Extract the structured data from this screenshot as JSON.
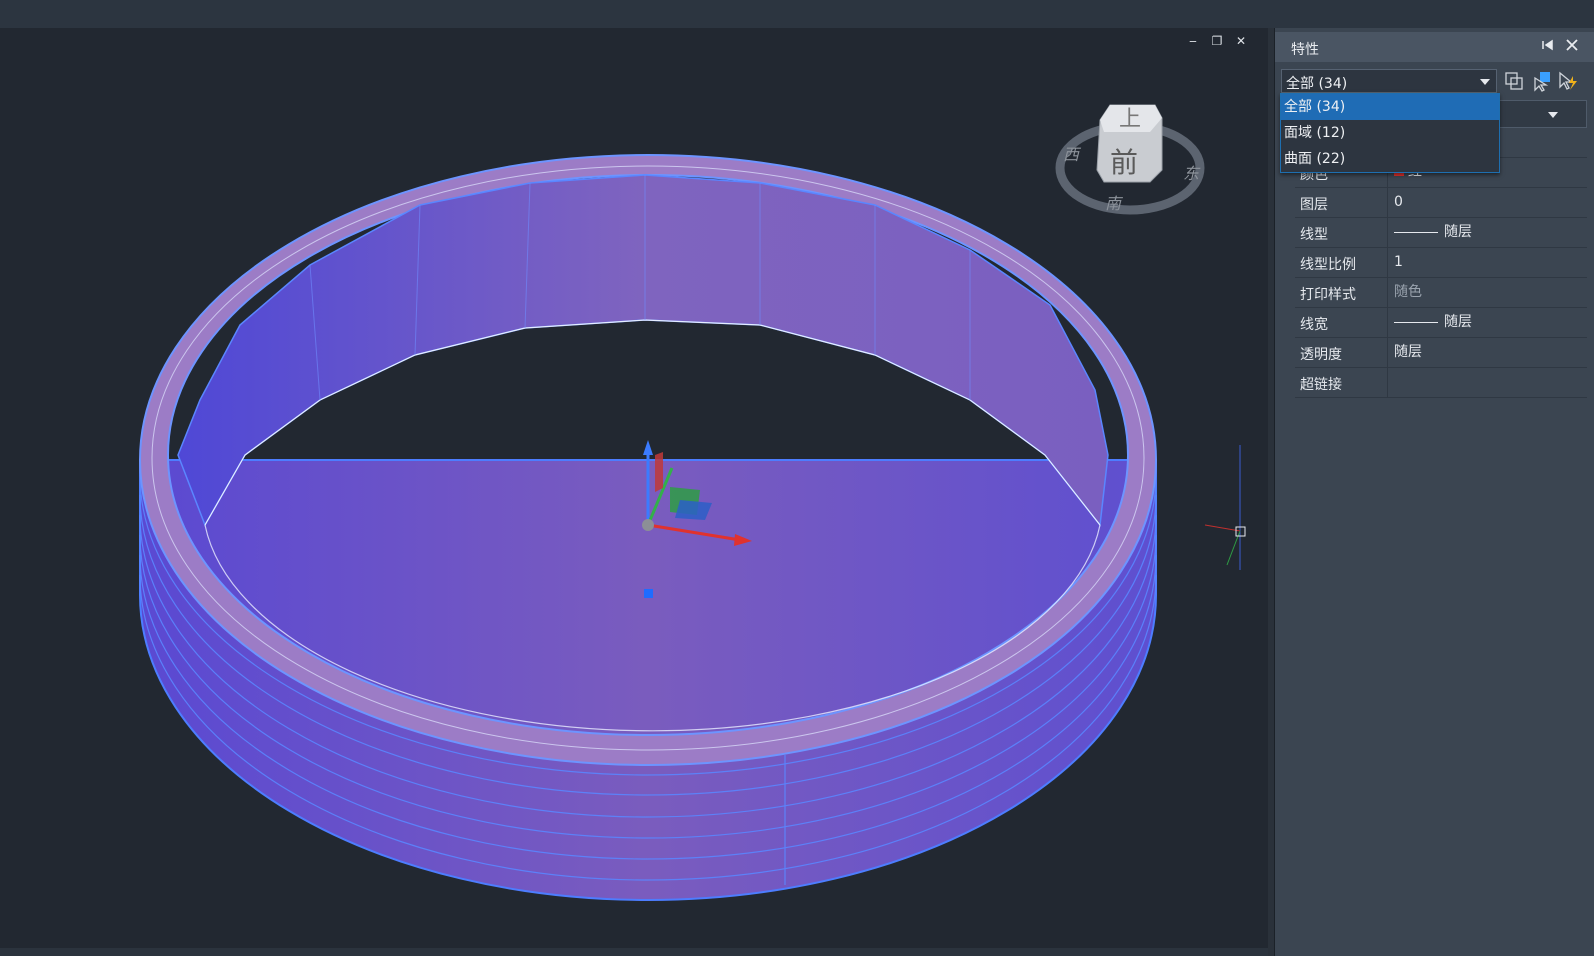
{
  "viewport": {
    "controls": {
      "minimize": "‒",
      "restore": "❐",
      "close": "✕"
    },
    "viewcube": {
      "top": "上",
      "front": "前",
      "west": "西",
      "south": "南",
      "east": "东"
    }
  },
  "panel": {
    "title": "特性",
    "selection_filter": "全部 (34)",
    "dropdown_options": [
      "全部 (34)",
      "面域 (12)",
      "曲面 (22)"
    ],
    "selected_option_index": 0,
    "properties": [
      {
        "key": "颜色",
        "value": "红"
      },
      {
        "key": "图层",
        "value": "0"
      },
      {
        "key": "线型",
        "value": "随层"
      },
      {
        "key": "线型比例",
        "value": "1"
      },
      {
        "key": "打印样式",
        "value": "随色"
      },
      {
        "key": "线宽",
        "value": "随层"
      },
      {
        "key": "透明度",
        "value": "随层"
      },
      {
        "key": "超链接",
        "value": ""
      }
    ]
  },
  "colors": {
    "viewport_bg": "#222831",
    "panel_bg": "#3b4551",
    "selection_blue": "#1f6cb5",
    "solid_face": "#6a5bc0",
    "edge_highlight": "#4d7dff"
  }
}
